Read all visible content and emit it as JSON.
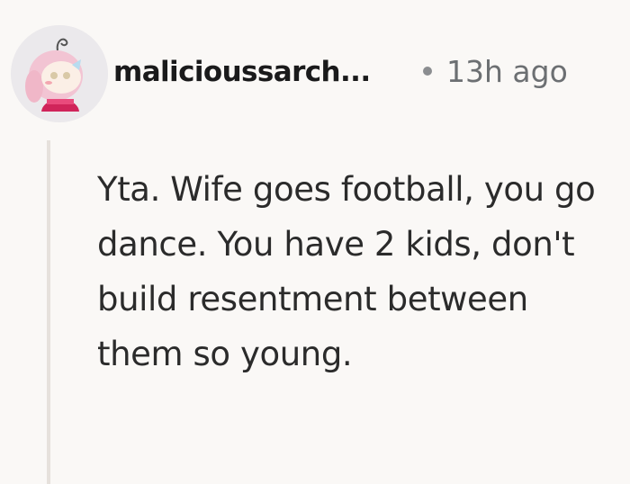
{
  "comment": {
    "author": "malicioussarch...",
    "timestamp": "13h ago",
    "body": "Yta. Wife goes football, you go dance. You have 2 kids, don't build resentment between them so young."
  }
}
